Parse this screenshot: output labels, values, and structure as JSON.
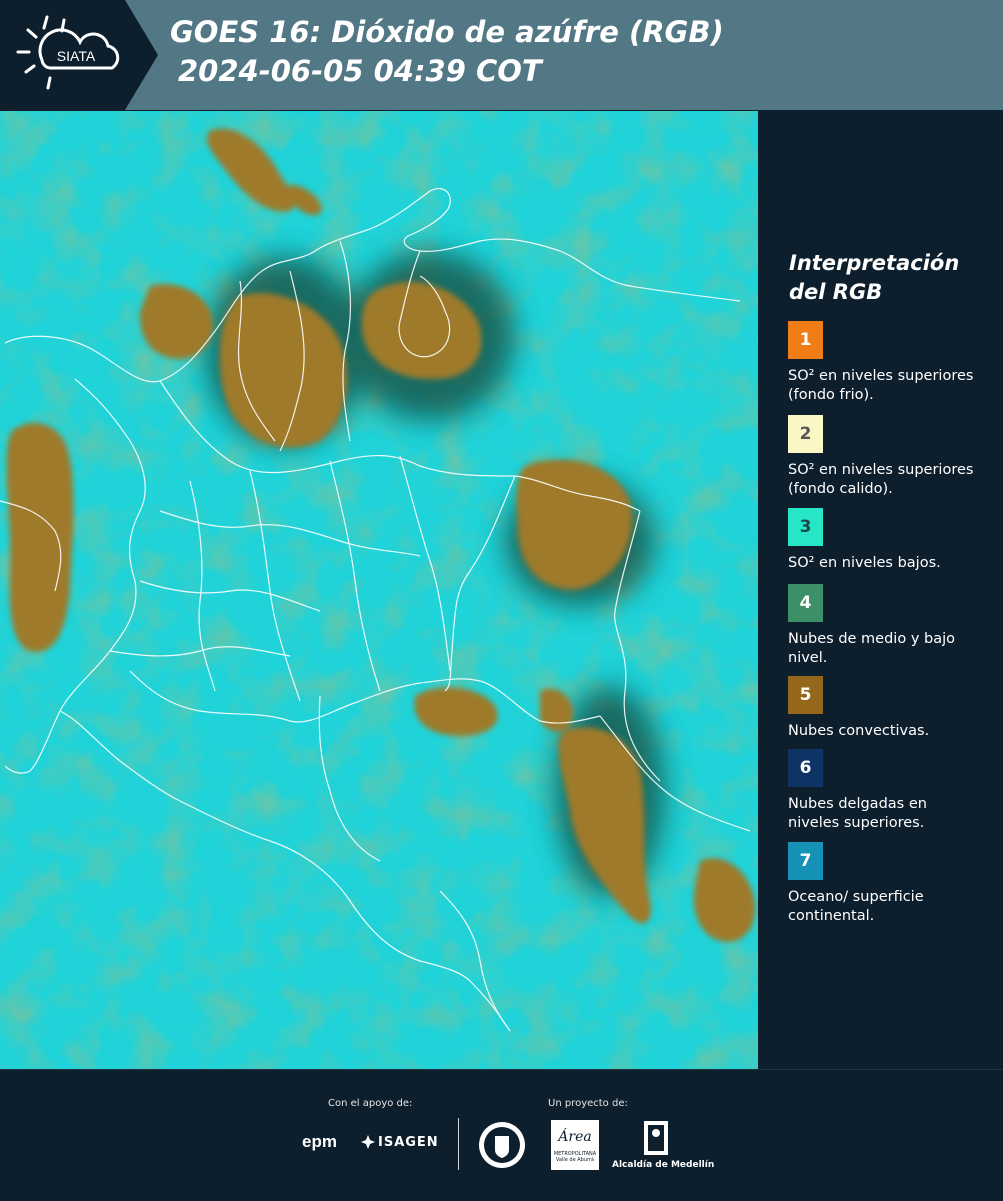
{
  "header": {
    "logo_text": "SIATA",
    "title_line1": "GOES 16: Dióxido de azúfre (RGB)",
    "title_line2": "2024-06-05 04:39 COT"
  },
  "legend": {
    "title_line1": "Interpretación",
    "title_line2": "del RGB",
    "items": [
      {
        "number": "1",
        "color": "#f07d16",
        "number_color": "#ffffff",
        "text": "SO² en niveles superiores (fondo frio)."
      },
      {
        "number": "2",
        "color": "#fbf6c6",
        "number_color": "#555555",
        "text": "SO² en niveles superiores (fondo calido)."
      },
      {
        "number": "3",
        "color": "#27e6c8",
        "number_color": "#1a4a4a",
        "text": "SO² en niveles bajos."
      },
      {
        "number": "4",
        "color": "#3c8f66",
        "number_color": "#ffffff",
        "text": "Nubes de medio y bajo nivel."
      },
      {
        "number": "5",
        "color": "#95671a",
        "number_color": "#ffffff",
        "text": "Nubes convectivas."
      },
      {
        "number": "6",
        "color": "#0e3466",
        "number_color": "#ffffff",
        "text": "Nubes delgadas en niveles superiores."
      },
      {
        "number": "7",
        "color": "#1592b6",
        "number_color": "#ffffff",
        "text": "Oceano/ superficie continental."
      }
    ]
  },
  "footer": {
    "support_label": "Con el apoyo de:",
    "project_label": "Un proyecto de:",
    "sponsor_epm": "epm",
    "sponsor_isagen": "ISAGEN",
    "area_logo": "Área",
    "area_sub": "METROPOLITANA",
    "area_sub2": "Valle de Aburrá",
    "alcaldia": "Alcaldía de Medellín"
  }
}
